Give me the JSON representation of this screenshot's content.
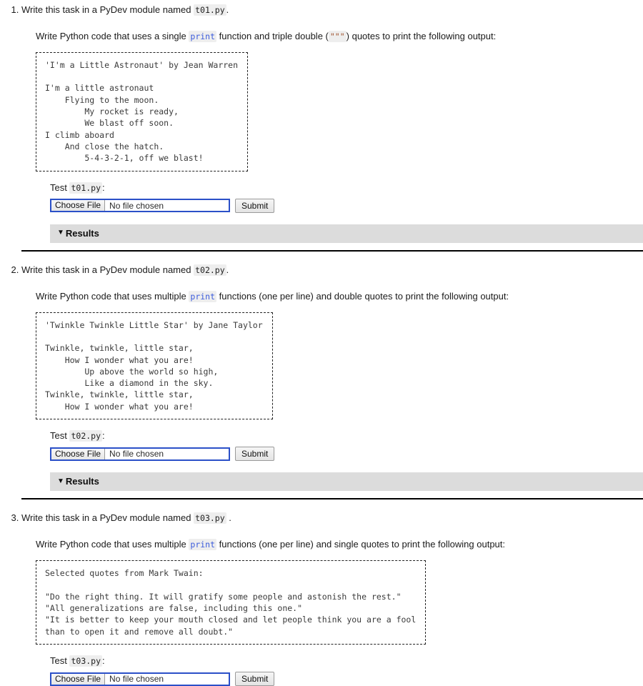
{
  "common": {
    "test_prefix": "Test",
    "test_suffix": ":",
    "choose_file_label": "Choose File",
    "no_file_label": "No file chosen",
    "submit_label": "Submit",
    "results_label": "Results",
    "triangle_glyph": "▼",
    "colors": {
      "keyword": "#3b5bdb",
      "string": "#a0522d",
      "code_bg": "#eeeeee",
      "results_bg": "#dcdcdc",
      "focus_border": "#2b50c8"
    }
  },
  "tasks": [
    {
      "number": "1.",
      "title_lead": "Write this task in a PyDev module named",
      "module": "t01.py",
      "title_tail": ".",
      "desc_lead": "Write Python code that uses a single",
      "desc_kw": "print",
      "desc_mid": "function and triple double (",
      "desc_str": "\"\"\"",
      "desc_tail": ") quotes to print the following output:",
      "code": "'I'm a Little Astronaut' by Jean Warren\n\nI'm a little astronaut\n    Flying to the moon.\n        My rocket is ready,\n        We blast off soon.\nI climb aboard\n    And close the hatch.\n        5-4-3-2-1, off we blast!",
      "test_module": "t01.py"
    },
    {
      "number": "2.",
      "title_lead": "Write this task in a PyDev module named",
      "module": "t02.py",
      "title_tail": ".",
      "desc_lead": "Write Python code that uses multiple",
      "desc_kw": "print",
      "desc_mid": "functions (one per line) and double quotes to print the following output:",
      "desc_str": "",
      "desc_tail": "",
      "code": "'Twinkle Twinkle Little Star' by Jane Taylor\n\nTwinkle, twinkle, little star,\n    How I wonder what you are!\n        Up above the world so high,\n        Like a diamond in the sky.\nTwinkle, twinkle, little star,\n    How I wonder what you are!",
      "test_module": "t02.py"
    },
    {
      "number": "3.",
      "title_lead": "Write this task in a PyDev module named",
      "module": "t03.py",
      "title_tail": " .",
      "desc_lead": "Write Python code that uses multiple",
      "desc_kw": "print",
      "desc_mid": "functions (one per line) and single quotes to print the following output:",
      "desc_str": "",
      "desc_tail": "",
      "code": "Selected quotes from Mark Twain:\n\n\"Do the right thing. It will gratify some people and astonish the rest.\"\n\"All generalizations are false, including this one.\"\n\"It is better to keep your mouth closed and let people think you are a fool\nthan to open it and remove all doubt.\"",
      "test_module": "t03.py"
    }
  ]
}
